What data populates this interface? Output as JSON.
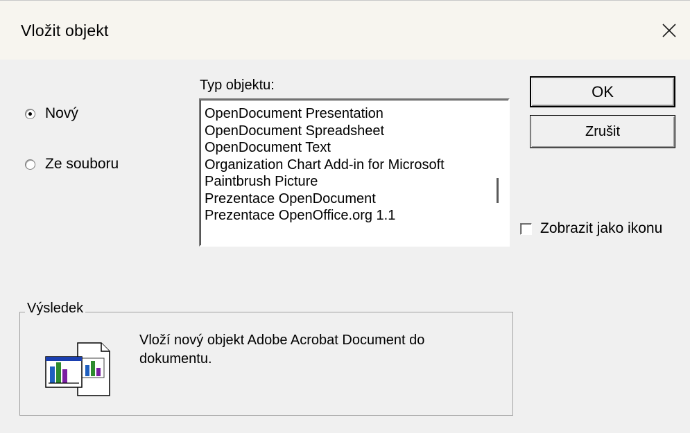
{
  "window": {
    "title": "Vložit objekt"
  },
  "radios": [
    {
      "label": "Nový",
      "checked": true
    },
    {
      "label": "Ze souboru",
      "checked": false
    }
  ],
  "object_type": {
    "label": "Typ objektu:",
    "items": [
      "OpenDocument Presentation",
      "OpenDocument Spreadsheet",
      "OpenDocument Text",
      "Organization Chart Add-in for Microsoft",
      "Paintbrush Picture",
      "Prezentace OpenDocument",
      "Prezentace OpenOffice.org 1.1"
    ]
  },
  "buttons": {
    "ok": "OK",
    "cancel": "Zrušit"
  },
  "display_as_icon": {
    "label": "Zobrazit jako ikonu",
    "checked": false
  },
  "result": {
    "label": "Výsledek",
    "text": "Vloží nový objekt Adobe Acrobat Document do dokumentu.",
    "icon": "insert-object-icon"
  }
}
